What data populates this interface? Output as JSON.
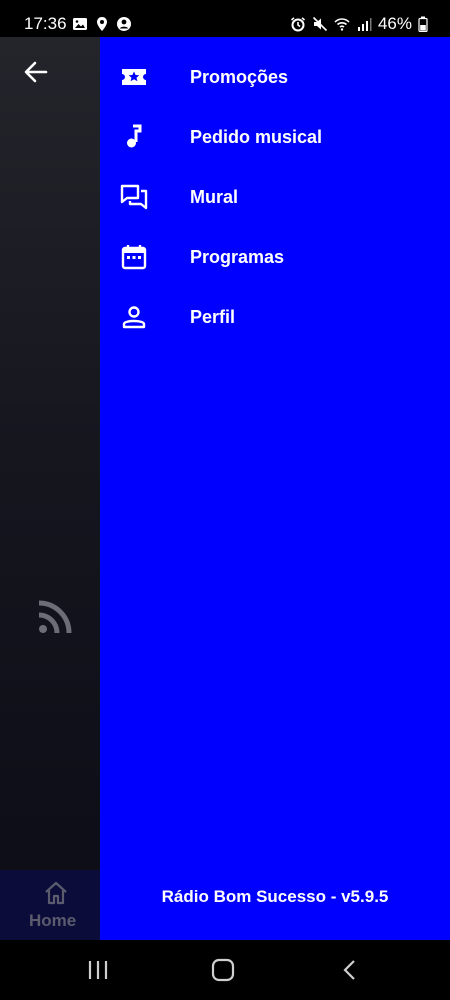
{
  "status_bar": {
    "time": "17:36",
    "battery": "46%",
    "icons": [
      "image-icon",
      "location-icon",
      "account-icon",
      "alarm-icon",
      "mute-icon",
      "wifi-icon",
      "signal-icon",
      "battery-icon"
    ]
  },
  "background_app": {
    "tab_label": "Home"
  },
  "drawer": {
    "items": [
      {
        "label": "Promoções",
        "icon": "ticket-star-icon"
      },
      {
        "label": "Pedido musical",
        "icon": "music-note-icon"
      },
      {
        "label": "Mural",
        "icon": "forum-icon"
      },
      {
        "label": "Programas",
        "icon": "calendar-icon"
      },
      {
        "label": "Perfil",
        "icon": "person-icon"
      }
    ],
    "version": "Rádio Bom Sucesso - v5.9.5"
  },
  "colors": {
    "drawer_bg": "#0000ff",
    "text": "#ffffff",
    "status_bg": "#000000"
  }
}
